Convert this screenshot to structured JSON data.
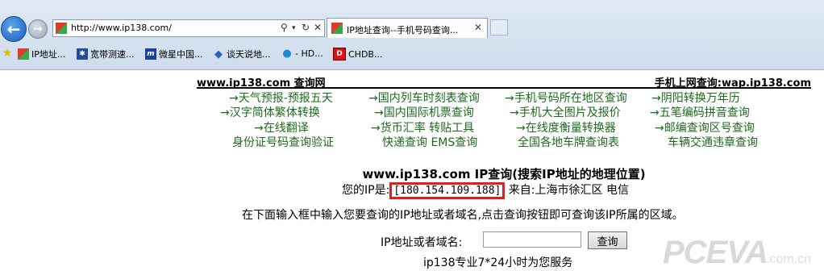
{
  "browser": {
    "url": "http://www.ip138.com/",
    "search_icon": "search-icon",
    "refresh_icon": "refresh-icon",
    "tab_title": "IP地址查询--手机号码查询...",
    "favorites": [
      "IP地址...",
      "宽带测速...",
      "微星中国...",
      "谈天说地...",
      "- HD...",
      "CHDB..."
    ]
  },
  "page": {
    "site_title": "www.ip138.com 查询网",
    "mobile_title": "手机上网查询:wap.ip138.com",
    "links": [
      "→天气预报-预报五天",
      "→国内列车时刻表查询",
      "→手机号码所在地区查询",
      "→阴阳转换万年历",
      "→汉字简体繁体转换",
      "→国内国际机票查询",
      "→手机大全图片及报价",
      "→五笔编码拼音查询",
      "→在线翻译",
      "→货币汇率 转贴工具",
      "→在线度衡量转换器",
      "→邮编查询区号查询",
      "身份证号码查询验证",
      "快递查询 EMS查询",
      "全国各地车牌查询表",
      "车辆交通违章查询"
    ],
    "query_title": "www.ip138.com IP查询(搜索IP地址的地理位置)",
    "ip_prefix": "您的IP是:",
    "ip": "[180.154.109.188]",
    "ip_location": " 来自:上海市徐汇区 电信",
    "instruction": "在下面输入框中输入您要查询的IP地址或者域名,点击查询按钮即可查询该IP所属的区域。",
    "form_label": "IP地址或者域名:",
    "query_button": "查询",
    "footer": "ip138专业7*24小时为您服务",
    "watermark": "PCEVA",
    "watermark_sub": ".com.cn"
  },
  "colors": {
    "link": "#1c6b1c",
    "highlight": "#e02020"
  }
}
